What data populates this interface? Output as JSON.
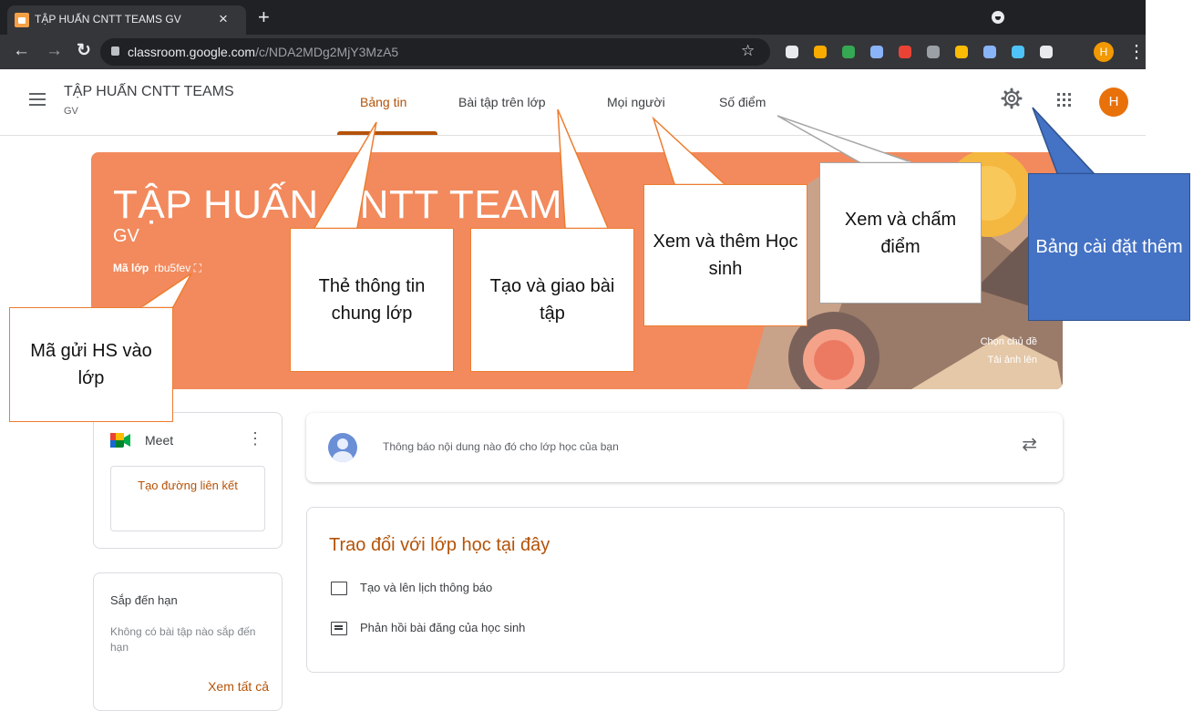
{
  "browser": {
    "tab_title": "TẬP HUẤN CNTT TEAMS GV",
    "tab_close": "×",
    "new_tab": "+",
    "url_host": "classroom.google.com",
    "url_path": "/c/NDA2MDg2MjY3MzA5",
    "profile_initial": "H",
    "star": "☆",
    "extensions": [
      "#e8eaed",
      "#f9ab00",
      "#34a853",
      "#8ab4f8",
      "#ea4335",
      "#9aa0a6",
      "#fbbc04",
      "#8ab4f8",
      "#4fc3f7",
      "#e8eaed"
    ]
  },
  "classroom": {
    "class_name": "TẬP HUẤN CNTT TEAMS",
    "section": "GV",
    "tabs": [
      {
        "label": "Bảng tin",
        "active": true
      },
      {
        "label": "Bài tập trên lớp"
      },
      {
        "label": "Mọi người"
      },
      {
        "label": "Số điểm"
      }
    ],
    "avatar_initial": "H"
  },
  "banner": {
    "title": "TẬP HUẤN CNTT TEAMS",
    "section": "GV",
    "code_label": "Mã lớp",
    "code_value": "rbu5fev",
    "select_theme": "Chọn chủ đề",
    "upload_photo": "Tải ảnh lên",
    "color": "#f28a5d"
  },
  "meet": {
    "label": "Meet",
    "create_link": "Tạo đường liên kết"
  },
  "upcoming": {
    "title": "Sắp đến hạn",
    "empty_text": "Không có bài tập nào sắp đến hạn",
    "view_all": "Xem tất cả"
  },
  "announce": {
    "placeholder": "Thông báo nội dung nào đó cho lớp học của bạn"
  },
  "stream_intro": {
    "title": "Trao đổi với lớp học tại đây",
    "items": [
      "Tạo và lên lịch thông báo",
      "Phản hồi bài đăng của học sinh"
    ]
  },
  "callouts": {
    "class_info": "Thẻ thông tin chung lớp",
    "assign": "Tạo và giao bài tập",
    "people": "Xem và thêm Học sinh",
    "grades": "Xem và chấm điểm",
    "settings": "Bảng cài đặt thêm",
    "class_code": "Mã gửi HS vào lớp"
  },
  "colors": {
    "accent": "#b45309",
    "callout_border": "#ed7d31",
    "callout_blue": "#4472c4"
  }
}
